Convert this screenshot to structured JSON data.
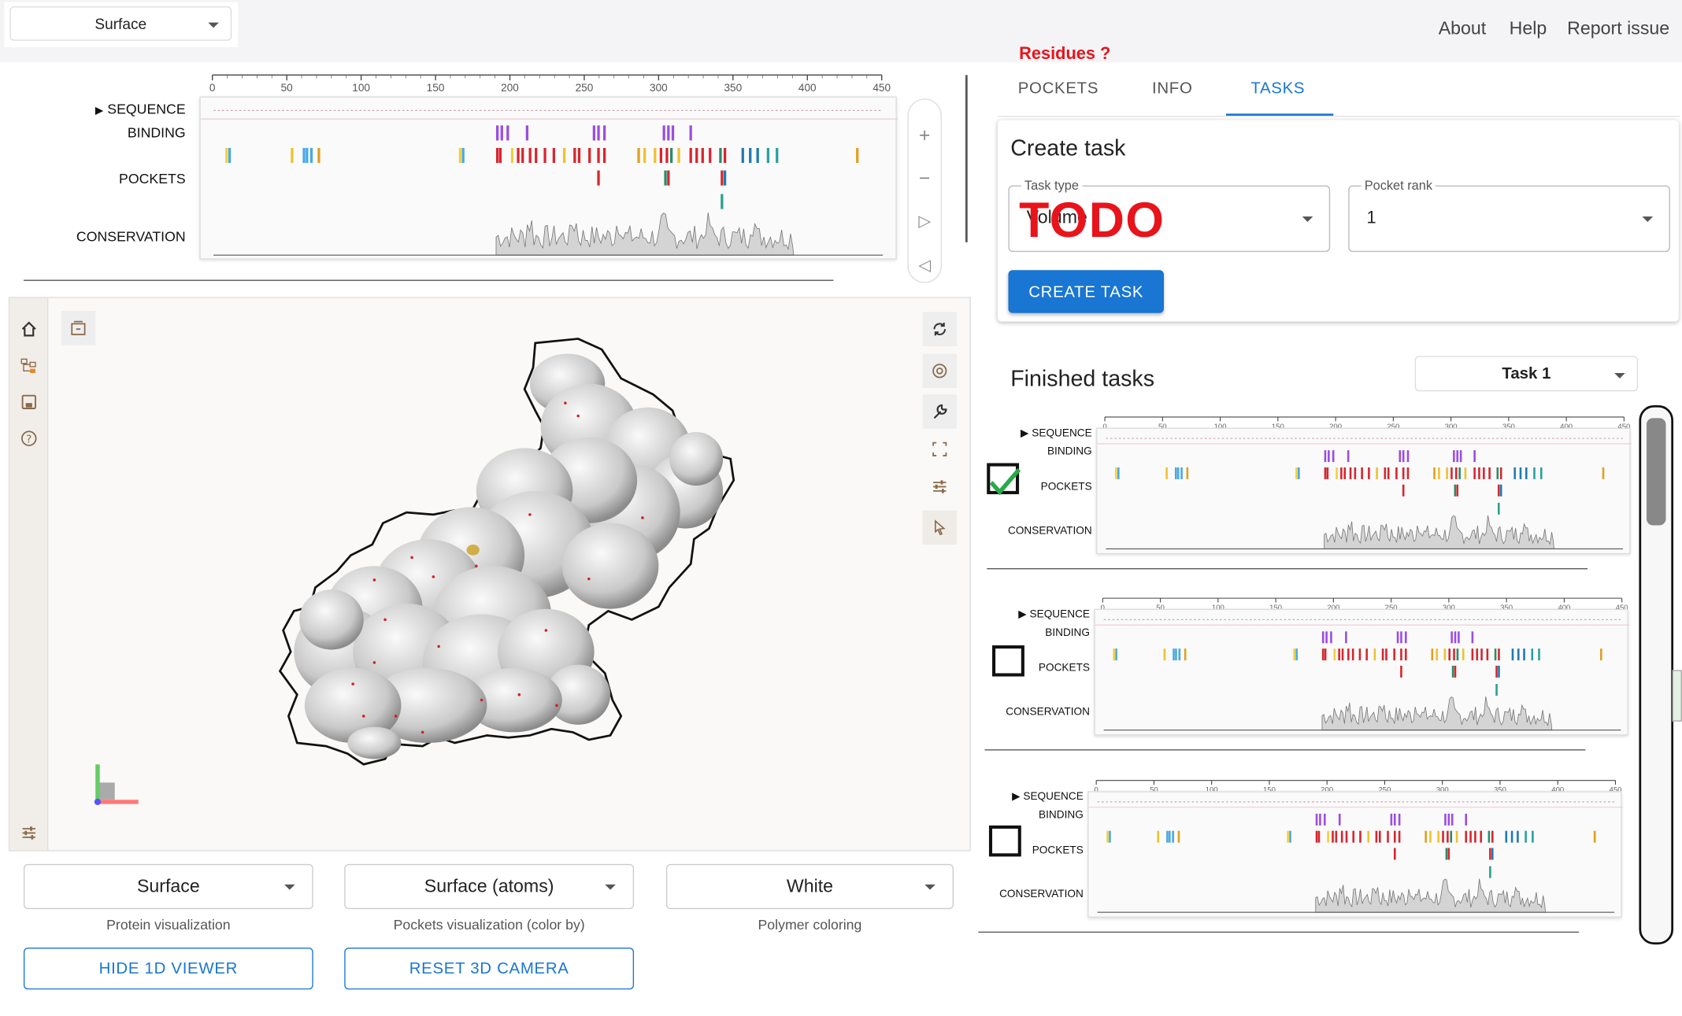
{
  "top": {
    "structure_select": "Surface",
    "nav": [
      "About",
      "Help",
      "Report issue"
    ]
  },
  "viewer1d": {
    "rows": [
      "SEQUENCE",
      "BINDING",
      "POCKETS",
      "CONSERVATION"
    ],
    "ticks": [
      "0",
      "50",
      "100",
      "150",
      "200",
      "250",
      "300",
      "350",
      "400",
      "450"
    ]
  },
  "annotation": {
    "residues_note": "Residues ?",
    "todo": "TODO"
  },
  "tabs": [
    "POCKETS",
    "INFO",
    "TASKS"
  ],
  "create_task": {
    "title": "Create task",
    "task_type_label": "Task type",
    "task_type_value": "Volume",
    "pocket_rank_label": "Pocket rank",
    "pocket_rank_value": "1",
    "button": "CREATE TASK"
  },
  "finished": {
    "title": "Finished tasks",
    "task_select": "Task 1"
  },
  "bottom": {
    "protein_vis": "Surface",
    "protein_vis_caption": "Protein visualization",
    "pockets_vis": "Surface (atoms)",
    "pockets_vis_caption": "Pockets visualization (color by)",
    "polymer_color": "White",
    "polymer_color_caption": "Polymer coloring",
    "hide_1d": "HIDE 1D VIEWER",
    "reset_cam": "RESET 3D CAMERA"
  },
  "colors": {
    "accent": "#1976d2",
    "todo_red": "#e8141b",
    "binding_purple": "#9b4de0",
    "pocket_red": "#d6262f",
    "check_green": "#2aa84a"
  }
}
